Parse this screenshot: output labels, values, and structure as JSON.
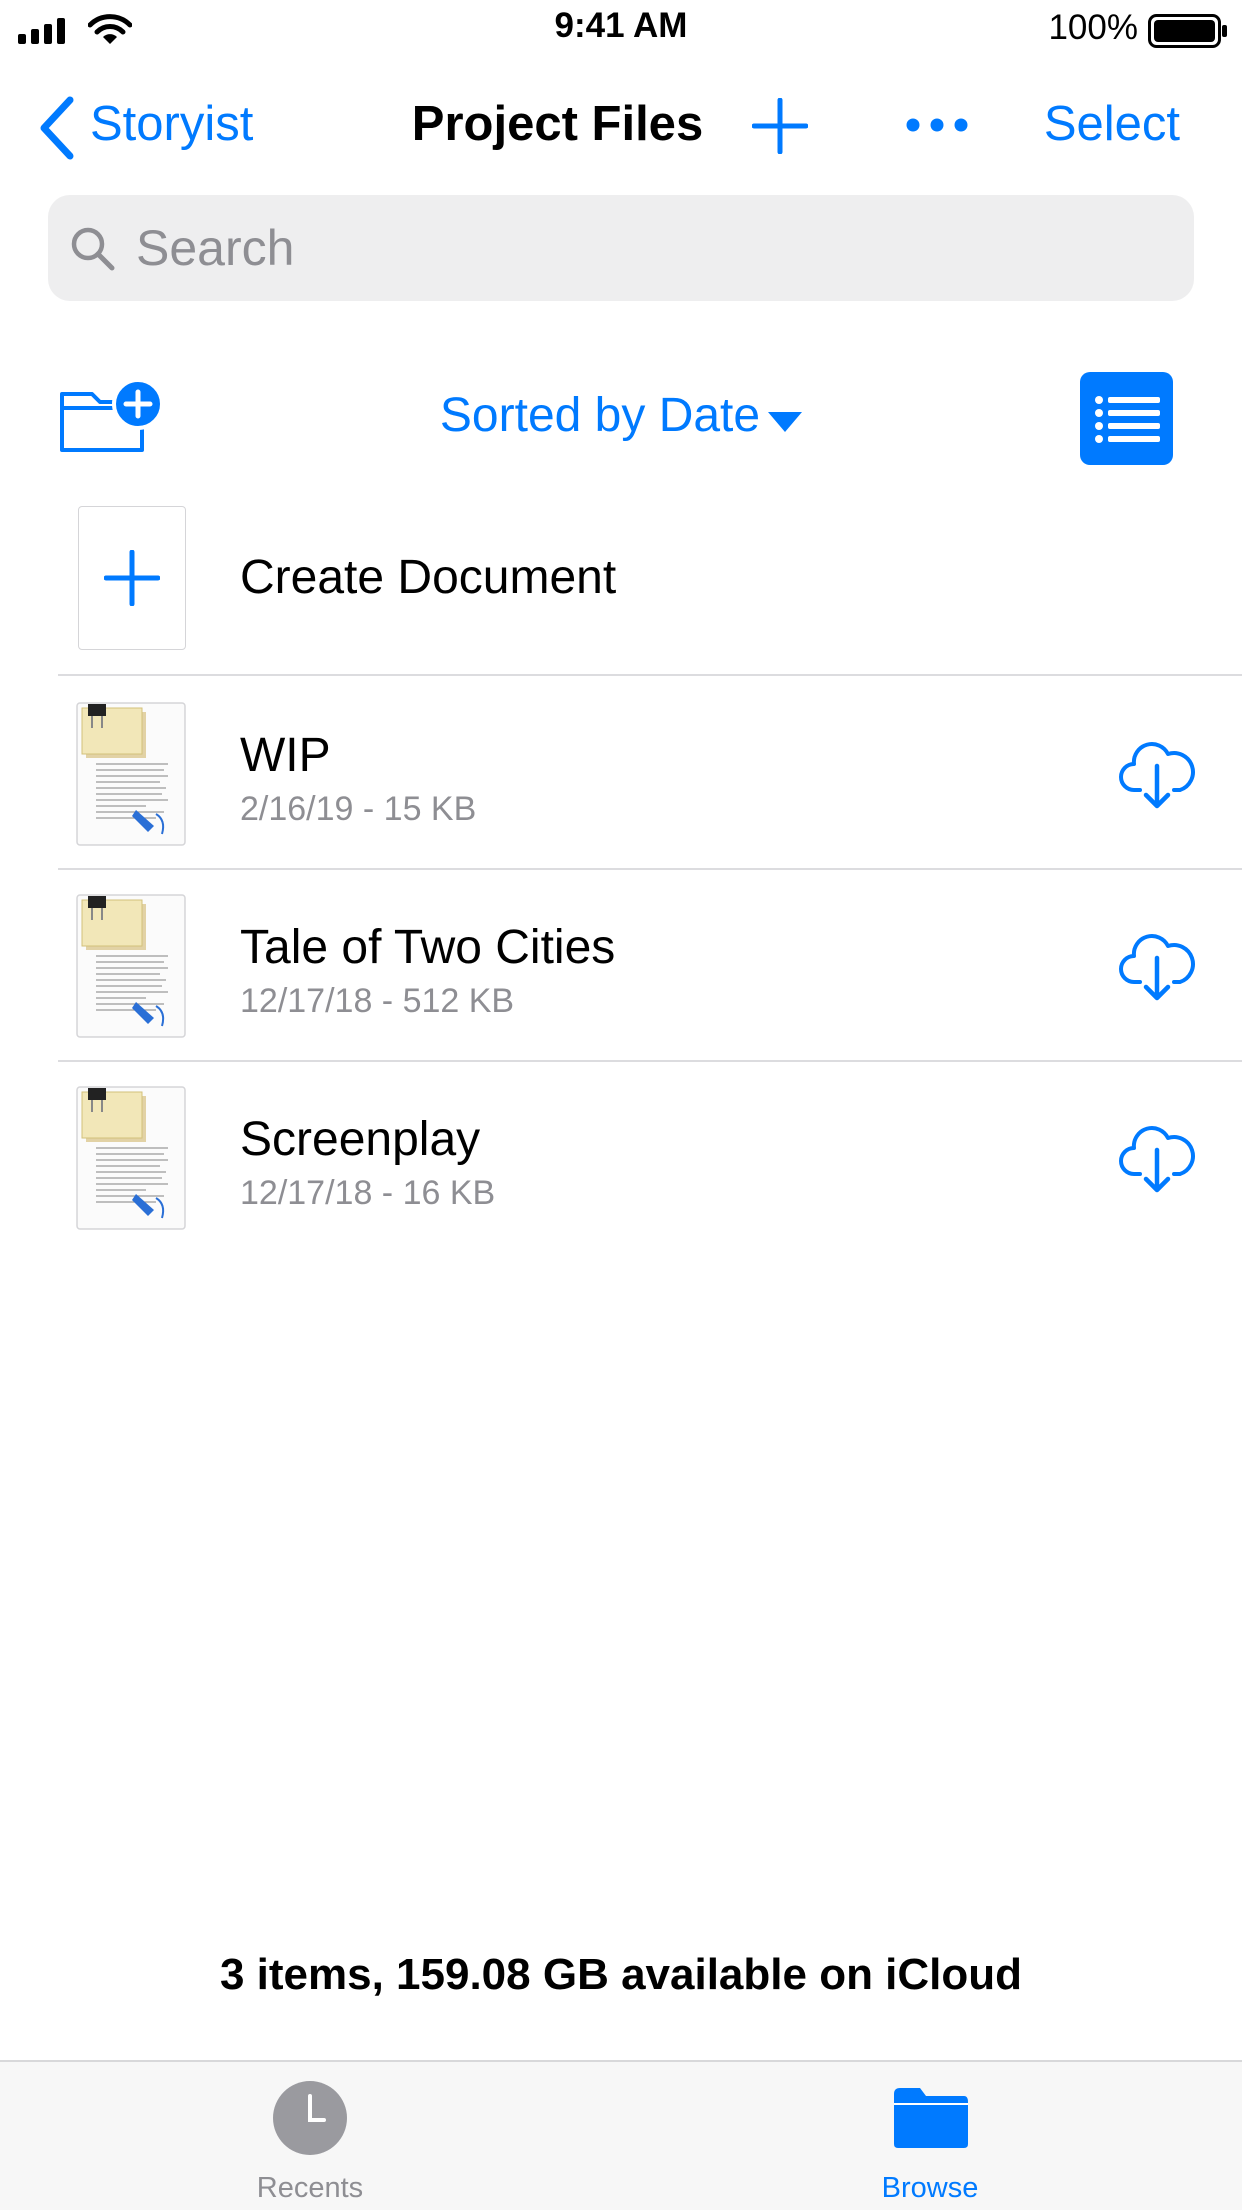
{
  "status_bar": {
    "time": "9:41 AM",
    "battery_percent": "100%"
  },
  "nav": {
    "back_label": "Storyist",
    "title": "Project Files",
    "select_label": "Select"
  },
  "search": {
    "placeholder": "Search",
    "value": ""
  },
  "toolbar": {
    "sort_label": "Sorted by Date"
  },
  "create": {
    "label": "Create Document"
  },
  "files": [
    {
      "name": "WIP",
      "meta": "2/16/19 - 15 KB"
    },
    {
      "name": "Tale of Two Cities",
      "meta": "12/17/18 - 512 KB"
    },
    {
      "name": "Screenplay",
      "meta": "12/17/18 - 16 KB"
    }
  ],
  "footer": {
    "summary": "3 items, 159.08 GB available on iCloud"
  },
  "tabs": [
    {
      "label": "Recents",
      "icon": "clock-icon",
      "active": false
    },
    {
      "label": "Browse",
      "icon": "folder-icon",
      "active": true
    }
  ],
  "colors": {
    "accent": "#007aff",
    "secondary_text": "#8e8e93",
    "inactive_tab": "#8e8e93"
  }
}
